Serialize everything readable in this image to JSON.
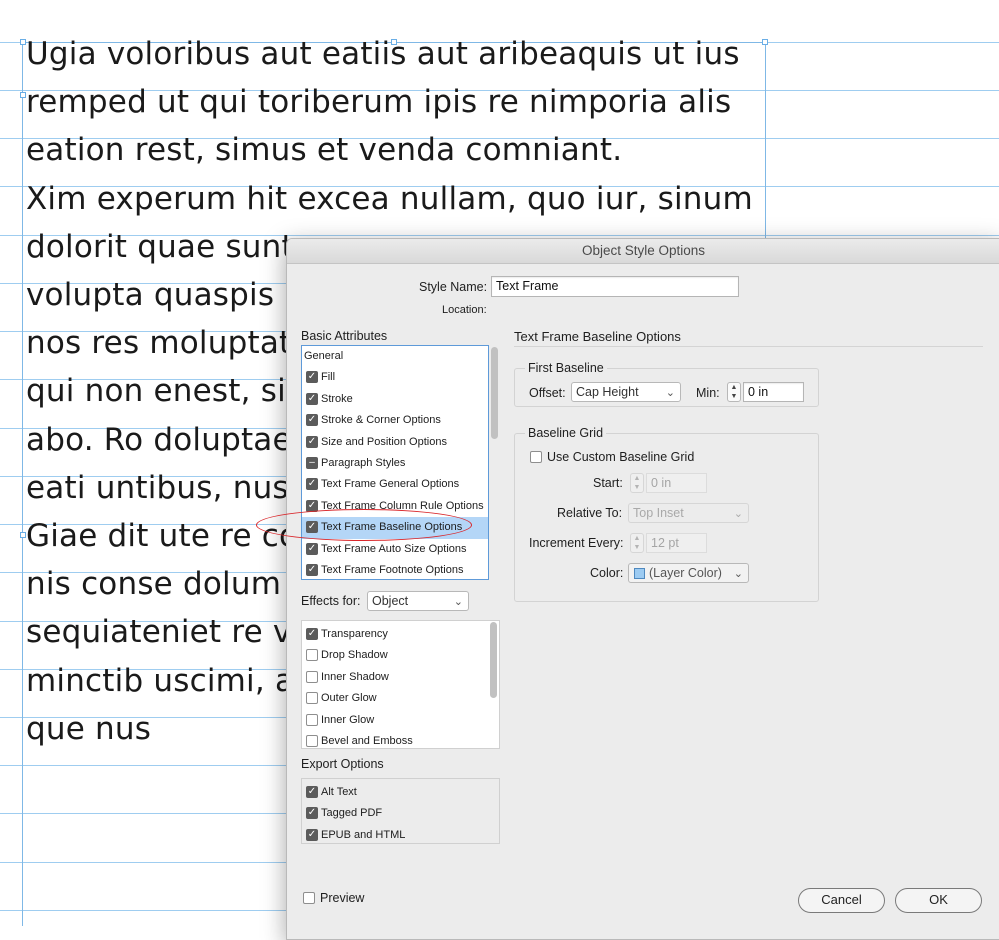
{
  "document": {
    "lines": [
      "Ugia voloribus aut eatiis aut aribeaquis ut ius",
      "remped ut qui toriberum ipis re nimporia alis",
      "eation rest, simus et venda comniant.",
      "Xim experum hit excea nullam, quo iur, sinum",
      "dolorit quae sunt",
      "volupta quaspis",
      "nos res moluptat",
      "qui non enest, sit",
      "abo. Ro doluptae",
      "eati untibus, nus",
      "Giae dit ute re co",
      "nis conse dolum",
      "sequiateniet re v",
      "minctib uscimi, a",
      "que nus"
    ]
  },
  "dialog": {
    "title": "Object Style Options",
    "style_name_label": "Style Name:",
    "style_name_value": "Text Frame",
    "location_label": "Location:",
    "basic_attributes_label": "Basic Attributes",
    "basic_attributes": [
      {
        "label": "General",
        "state": "none"
      },
      {
        "label": "Fill",
        "state": "on"
      },
      {
        "label": "Stroke",
        "state": "on"
      },
      {
        "label": "Stroke & Corner Options",
        "state": "on"
      },
      {
        "label": "Size and Position Options",
        "state": "on"
      },
      {
        "label": "Paragraph Styles",
        "state": "mixed"
      },
      {
        "label": "Text Frame General Options",
        "state": "on"
      },
      {
        "label": "Text Frame Column Rule Options",
        "state": "on"
      },
      {
        "label": "Text Frame Baseline Options",
        "state": "on",
        "selected": true
      },
      {
        "label": "Text Frame Auto Size Options",
        "state": "on"
      },
      {
        "label": "Text Frame Footnote Options",
        "state": "on"
      }
    ],
    "effects_for_label": "Effects for:",
    "effects_for_value": "Object",
    "effects": [
      {
        "label": "Transparency",
        "state": "on"
      },
      {
        "label": "Drop Shadow",
        "state": "off"
      },
      {
        "label": "Inner Shadow",
        "state": "off"
      },
      {
        "label": "Outer Glow",
        "state": "off"
      },
      {
        "label": "Inner Glow",
        "state": "off"
      },
      {
        "label": "Bevel and Emboss",
        "state": "off"
      }
    ],
    "export_options_label": "Export Options",
    "export_options": [
      {
        "label": "Alt Text",
        "state": "on"
      },
      {
        "label": "Tagged PDF",
        "state": "on"
      },
      {
        "label": "EPUB and HTML",
        "state": "on"
      }
    ],
    "panel_title": "Text Frame Baseline Options",
    "first_baseline": {
      "group_label": "First Baseline",
      "offset_label": "Offset:",
      "offset_value": "Cap Height",
      "min_label": "Min:",
      "min_value": "0 in"
    },
    "baseline_grid": {
      "group_label": "Baseline Grid",
      "use_custom_label": "Use Custom Baseline Grid",
      "use_custom_checked": false,
      "start_label": "Start:",
      "start_value": "0 in",
      "relative_to_label": "Relative To:",
      "relative_to_value": "Top Inset",
      "increment_label": "Increment Every:",
      "increment_value": "12 pt",
      "color_label": "Color:",
      "color_value": "(Layer Color)"
    },
    "preview_label": "Preview",
    "cancel_label": "Cancel",
    "ok_label": "OK",
    "colors": {
      "selection": "#b4d6f7",
      "highlight_ellipse": "#d9262a",
      "layer_color": "#9ccbf2",
      "guide_line": "#9fcdf0"
    }
  }
}
